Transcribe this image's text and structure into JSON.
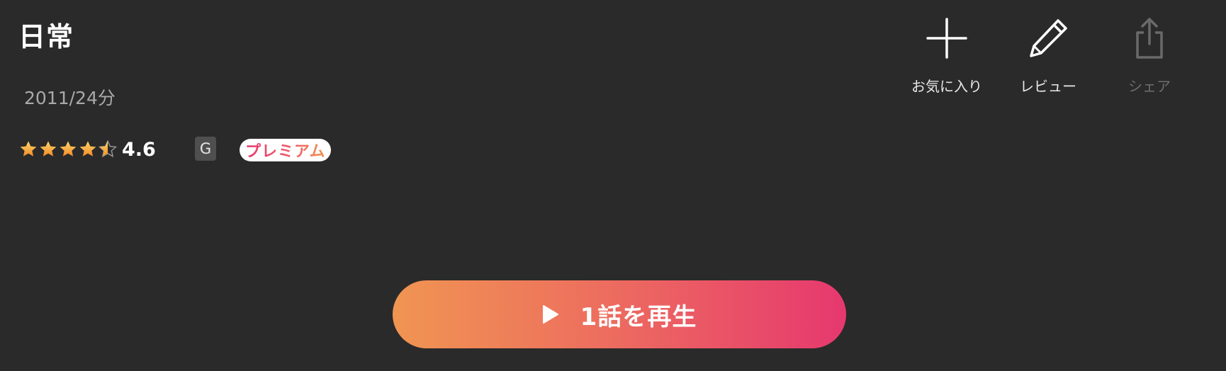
{
  "title": "日常",
  "meta": "2011/24分",
  "rating": {
    "value_label": "4.6",
    "value": 4.6,
    "max": 5,
    "star_color": "#f3a03a"
  },
  "age_rating": "G",
  "premium_badge": "プレミアム",
  "actions": {
    "favorite": {
      "label": "お気に入り",
      "icon": "plus-icon"
    },
    "review": {
      "label": "レビュー",
      "icon": "pencil-icon"
    },
    "share": {
      "label": "シェア",
      "icon": "share-icon",
      "disabled": true
    }
  },
  "play_button": {
    "label": "1話を再生",
    "icon": "play-icon",
    "gradient": [
      "#f09552",
      "#e6386f"
    ]
  }
}
